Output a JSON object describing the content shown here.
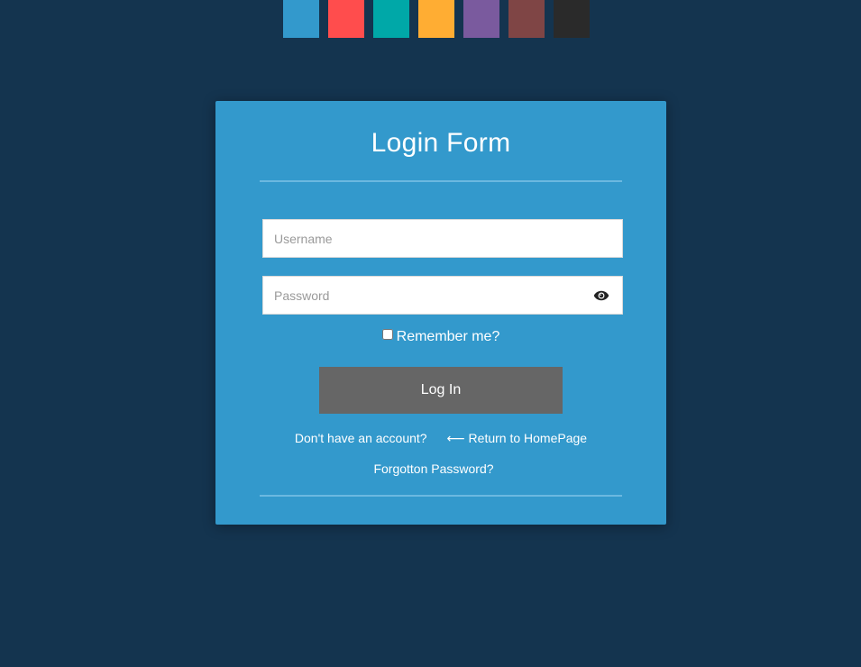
{
  "theme_swatches": [
    {
      "name": "blue",
      "color": "#3399cc"
    },
    {
      "name": "red",
      "color": "#ff4d4d"
    },
    {
      "name": "teal",
      "color": "#00a8a8"
    },
    {
      "name": "orange",
      "color": "#ffad33"
    },
    {
      "name": "purple",
      "color": "#7a5a9e"
    },
    {
      "name": "brown",
      "color": "#7f4545"
    },
    {
      "name": "dark",
      "color": "#2a2a2a"
    }
  ],
  "form": {
    "title": "Login Form",
    "username_placeholder": "Username",
    "username_value": "",
    "password_placeholder": "Password",
    "password_value": "",
    "password_toggle_icon": "eye-icon",
    "remember_label": "Remember me?",
    "remember_checked": false,
    "login_label": "Log In",
    "signup_link": "Don't have an account?",
    "home_link_arrow": "⟵",
    "home_link": "Return to HomePage",
    "forgot_link": "Forgotton Password?"
  },
  "colors": {
    "background": "#14344f",
    "card": "#3399cc",
    "button": "#666666"
  }
}
